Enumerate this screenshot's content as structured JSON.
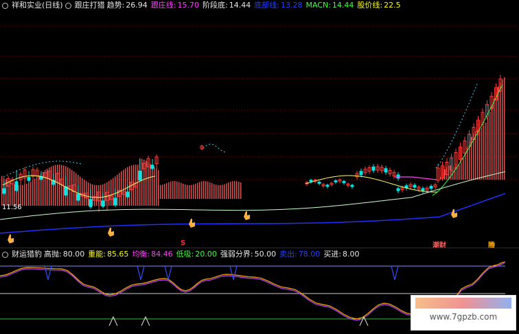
{
  "top_bar": {
    "stock": "祥和实业(日线)",
    "indicator": "跟庄打猎",
    "items": [
      {
        "label": "趋势:",
        "value": "26.94",
        "label_color": "#e8e8e8",
        "value_color": "#e8e8e8"
      },
      {
        "label": "跟庄线:",
        "value": "15.70",
        "label_color": "#ff40ff",
        "value_color": "#ff40ff"
      },
      {
        "label": "阶段底:",
        "value": "14.44",
        "label_color": "#e8e8e8",
        "value_color": "#e8e8e8"
      },
      {
        "label": "底部线:",
        "value": "13.28",
        "label_color": "#2040ff",
        "value_color": "#2040ff"
      },
      {
        "label": "MACN:",
        "value": "14.44",
        "label_color": "#40ff40",
        "value_color": "#40ff40"
      },
      {
        "label": "股价线:",
        "value": "22.5",
        "label_color": "#ffff00",
        "value_color": "#ffff00"
      }
    ]
  },
  "main_chart": {
    "low_price_label": "11.56",
    "marker_labels": [
      "S"
    ],
    "signal_labels": [
      "潮财",
      "腾"
    ]
  },
  "indicator_bar": {
    "name": "财运猎豹",
    "items": [
      {
        "label": "高抛:",
        "value": "80.00",
        "label_color": "#e8e8e8",
        "value_color": "#e8e8e8"
      },
      {
        "label": "重能:",
        "value": "85.65",
        "label_color": "#ffff00",
        "value_color": "#ffff00"
      },
      {
        "label": "均衡:",
        "value": "84.46",
        "label_color": "#ff40ff",
        "value_color": "#ff40ff"
      },
      {
        "label": "低吸:",
        "value": "20.00",
        "label_color": "#40ff40",
        "value_color": "#40ff40"
      },
      {
        "label": "强弱分界:",
        "value": "50.00",
        "label_color": "#e8e8e8",
        "value_color": "#e8e8e8"
      },
      {
        "label": "卖出:",
        "value": "78.00",
        "label_color": "#2040ff",
        "value_color": "#2040ff"
      },
      {
        "label": "买进:",
        "value": "8.00",
        "label_color": "#e8e8e8",
        "value_color": "#e8e8e8"
      }
    ]
  },
  "watermark": {
    "url": "www.7gpzb.com"
  },
  "colors": {
    "background": "#000000",
    "up_candle": "#ff3b3b",
    "down_candle": "#00e5e5",
    "volume_bar": "#ff6060",
    "trend_line": "#ffff66",
    "support_line": "#ccffcc",
    "bottom_line": "#2030ff",
    "energy_line": "#ffaa00",
    "balance_line": "#c040ff",
    "grid_line": "#8b0000"
  },
  "icons": [
    "circle-icon",
    "hand-pointer-icon"
  ]
}
